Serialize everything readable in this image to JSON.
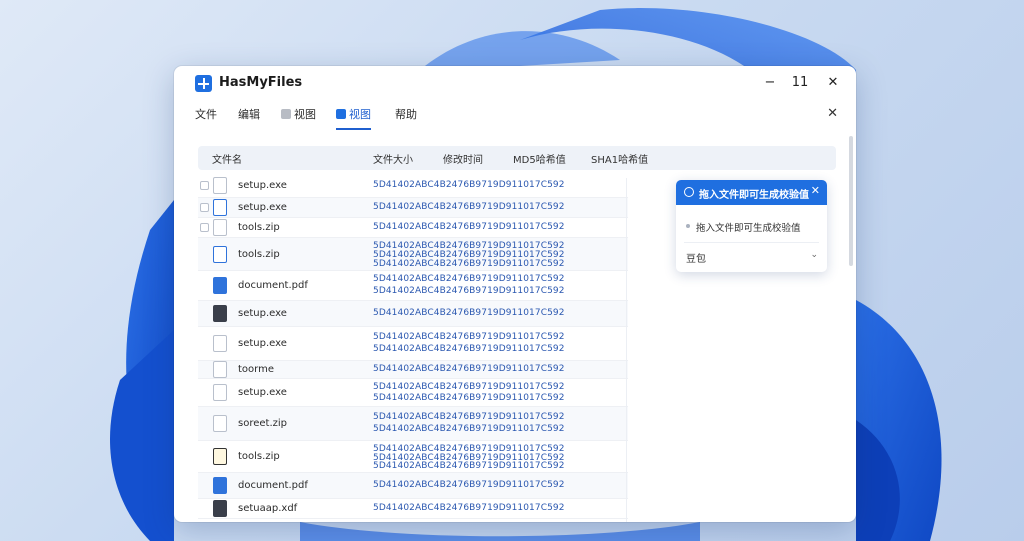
{
  "window": {
    "title": "HasMyFiles",
    "controls": {
      "minimize": "−",
      "maximize": "11",
      "close": "✕"
    },
    "panel_close": "✕"
  },
  "menu": {
    "items": [
      {
        "label": "文件",
        "active": false,
        "icon": ""
      },
      {
        "label": "编辑",
        "active": false,
        "icon": ""
      },
      {
        "label": "视图",
        "active": false,
        "icon": "home-icon"
      },
      {
        "label": "视图",
        "active": true,
        "icon": "cube-icon"
      },
      {
        "label": "帮助",
        "active": false,
        "icon": ""
      }
    ]
  },
  "table": {
    "columns": [
      "文件名",
      "文件大小",
      "修改时间",
      "MD5哈希值",
      "SHA1哈希值"
    ],
    "rows": [
      {
        "name": "setup.exe",
        "hashes": [
          "5D41402ABC4B2476B9719D911017C592"
        ],
        "checkbox": true
      },
      {
        "name": "setup.exe",
        "hashes": [
          "5D41402ABC4B2476B9719D911017C592"
        ],
        "checkbox": true
      },
      {
        "name": "tools.zip",
        "hashes": [
          "5D41402ABC4B2476B9719D911017C592"
        ],
        "checkbox": true
      },
      {
        "name": "tools.zip",
        "hashes": [
          "5D41402ABC4B2476B9719D911017C592",
          "5D41402ABC4B2476B9719D911017C592",
          "5D41402ABC4B2476B9719D911017C592"
        ],
        "checkbox": false
      },
      {
        "name": "document.pdf",
        "hashes": [
          "5D41402ABC4B2476B9719D911017C592",
          "5D41402ABC4B2476B9719D911017C592"
        ],
        "checkbox": false
      },
      {
        "name": "setup.exe",
        "hashes": [
          "5D41402ABC4B2476B9719D911017C592"
        ],
        "checkbox": false
      },
      {
        "name": "setup.exe",
        "hashes": [
          "5D41402ABC4B2476B9719D911017C592",
          "5D41402ABC4B2476B9719D911017C592"
        ],
        "checkbox": false
      },
      {
        "name": "toorme",
        "hashes": [
          "5D41402ABC4B2476B9719D911017C592"
        ],
        "checkbox": false
      },
      {
        "name": "setup.exe",
        "hashes": [
          "5D41402ABC4B2476B9719D911017C592",
          "5D41402ABC4B2476B9719D911017C592"
        ],
        "checkbox": false
      },
      {
        "name": "soreet.zip",
        "hashes": [
          "5D41402ABC4B2476B9719D911017C592",
          "5D41402ABC4B2476B9719D911017C592"
        ],
        "checkbox": false
      },
      {
        "name": "tools.zip",
        "hashes": [
          "5D41402ABC4B2476B9719D911017C592",
          "5D41402ABC4B2476B9719D911017C592",
          "5D41402ABC4B2476B9719D911017C592"
        ],
        "checkbox": false
      },
      {
        "name": "document.pdf",
        "hashes": [
          "5D41402ABC4B2476B9719D911017C592"
        ],
        "checkbox": false
      },
      {
        "name": "setuaap.xdf",
        "hashes": [
          "5D41402ABC4B2476B9719D911017C592"
        ],
        "checkbox": false
      }
    ]
  },
  "popup": {
    "title": "拖入文件即可生成校验值",
    "close": "✕",
    "item": "拖入文件即可生成校验值",
    "select_value": "豆包",
    "chevron": "⌄"
  },
  "colors": {
    "accent": "#1f6fe0",
    "hash_text": "#2b58b0"
  }
}
